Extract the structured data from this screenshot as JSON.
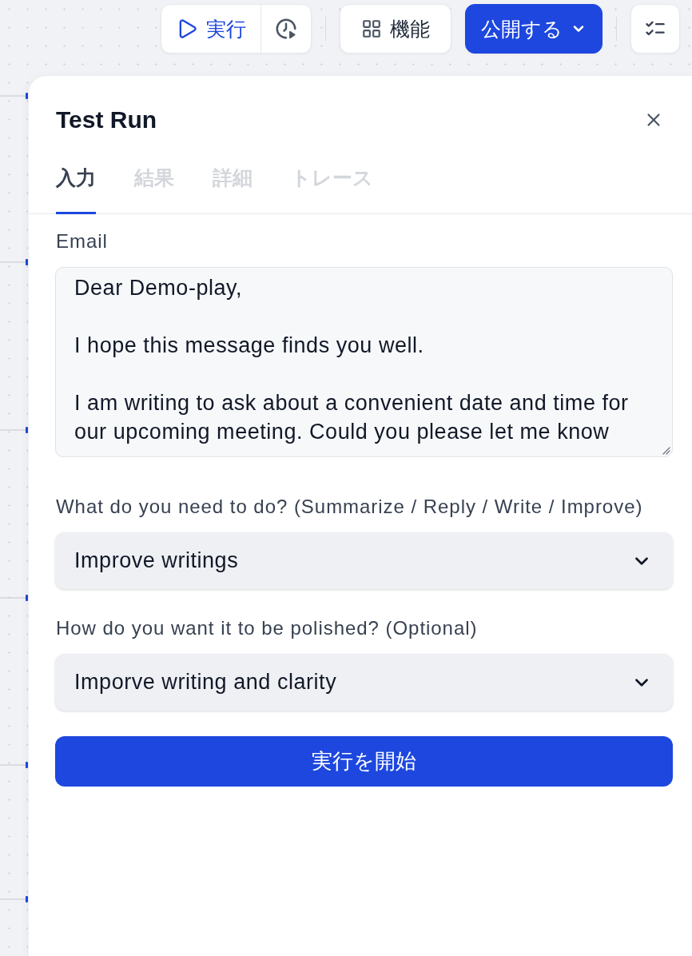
{
  "toolbar": {
    "run_button": {
      "label": "実行"
    },
    "features_button": {
      "label": "機能"
    },
    "publish_button": {
      "label": "公開する"
    }
  },
  "panel": {
    "title": "Test Run",
    "tabs": [
      {
        "label": "入力",
        "selected": true,
        "disabled": false
      },
      {
        "label": "結果",
        "selected": false,
        "disabled": true
      },
      {
        "label": "詳細",
        "selected": false,
        "disabled": true
      },
      {
        "label": "トレース",
        "selected": false,
        "disabled": true
      }
    ],
    "fields": [
      {
        "kind": "textarea",
        "label": "Email",
        "value": "Dear Demo-play,\n\nI hope this message finds you well.\n\nI am writing to ask about a convenient date and time for our upcoming meeting. Could you please let me know"
      },
      {
        "kind": "select",
        "label": "What do you need to do? (Summarize / Reply / Write / Improve)",
        "value": "Improve writings"
      },
      {
        "kind": "select",
        "label": "How do you want it to be polished? (Optional)",
        "value": "Imporve writing and clarity"
      }
    ],
    "submit_button": {
      "label": "実行を開始"
    }
  }
}
